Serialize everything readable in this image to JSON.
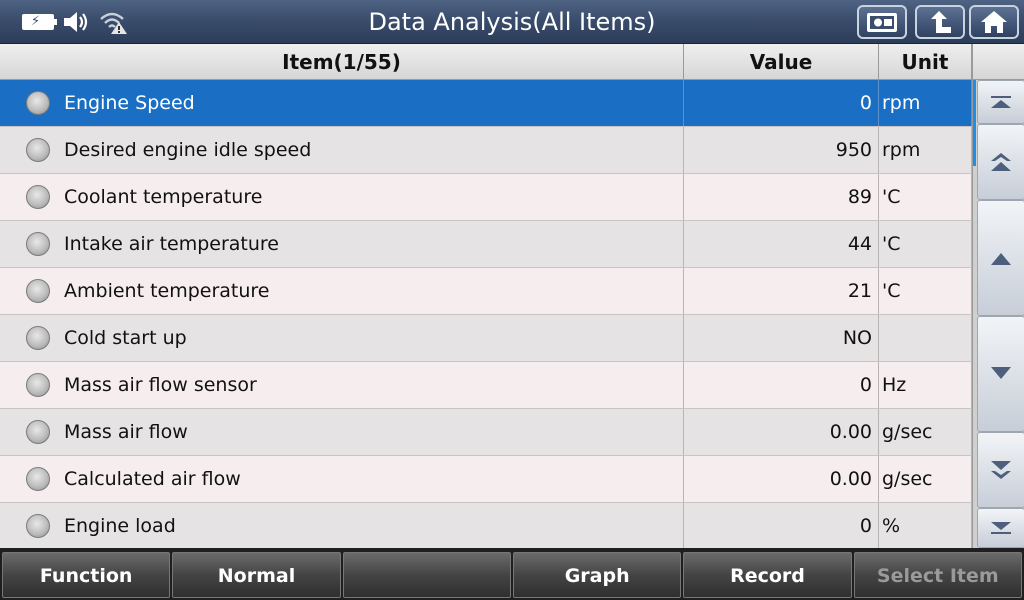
{
  "header": {
    "title": "Data Analysis(All Items)",
    "status_icons": [
      "battery-charging-icon",
      "speaker-icon",
      "wifi-warning-icon"
    ],
    "buttons": [
      "screenshot-icon",
      "back-icon",
      "home-icon"
    ]
  },
  "table": {
    "columns": {
      "item": "Item(1/55)",
      "value": "Value",
      "unit": "Unit"
    },
    "rows": [
      {
        "item": "Engine Speed",
        "value": "0",
        "unit": "rpm",
        "selected": true
      },
      {
        "item": "Desired engine idle speed",
        "value": "950",
        "unit": "rpm"
      },
      {
        "item": "Coolant temperature",
        "value": "89",
        "unit": "'C"
      },
      {
        "item": "Intake air temperature",
        "value": "44",
        "unit": "'C"
      },
      {
        "item": "Ambient temperature",
        "value": "21",
        "unit": "'C"
      },
      {
        "item": "Cold start up",
        "value": "NO",
        "unit": ""
      },
      {
        "item": "Mass air flow sensor",
        "value": "0",
        "unit": "Hz"
      },
      {
        "item": "Mass air flow",
        "value": "0.00",
        "unit": "g/sec"
      },
      {
        "item": "Calculated air flow",
        "value": "0.00",
        "unit": "g/sec"
      },
      {
        "item": "Engine load",
        "value": "0",
        "unit": "%"
      }
    ]
  },
  "scroll": {
    "buttons": [
      "scroll-top-icon",
      "page-up-icon",
      "line-up-icon",
      "line-down-icon",
      "page-down-icon",
      "scroll-bottom-icon"
    ]
  },
  "footer": {
    "buttons": [
      {
        "label": "Function",
        "enabled": true
      },
      {
        "label": "Normal",
        "enabled": true
      },
      {
        "label": "",
        "enabled": true
      },
      {
        "label": "Graph",
        "enabled": true
      },
      {
        "label": "Record",
        "enabled": true
      },
      {
        "label": "Select Item",
        "enabled": false
      }
    ]
  },
  "colors": {
    "selected_row": "#1a6fc4",
    "header_bar": "#3a4d6c"
  }
}
